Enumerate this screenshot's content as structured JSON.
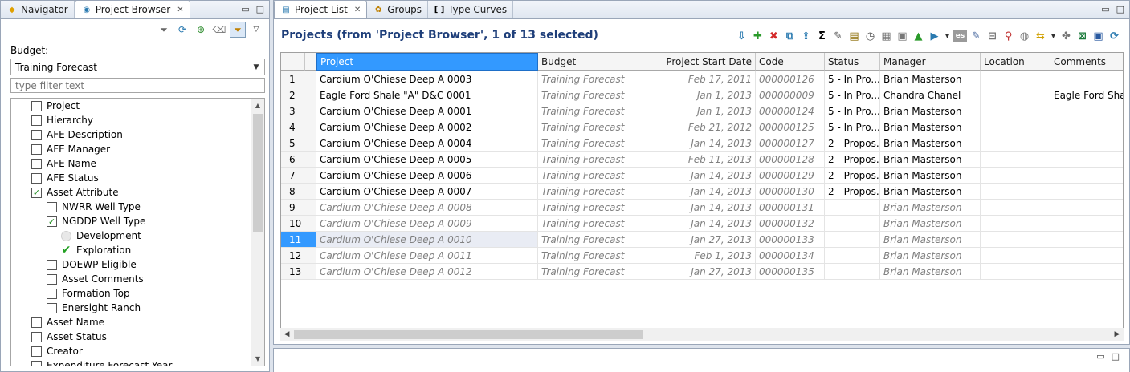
{
  "left_tabs": [
    {
      "label": "Navigator",
      "closable": false
    },
    {
      "label": "Project Browser",
      "closable": true
    }
  ],
  "budget": {
    "label": "Budget:",
    "selected": "Training Forecast",
    "filter_placeholder": "type filter text"
  },
  "tree_items": [
    {
      "label": "Project",
      "state": "unchecked"
    },
    {
      "label": "Hierarchy",
      "state": "unchecked"
    },
    {
      "label": "AFE Description",
      "state": "unchecked"
    },
    {
      "label": "AFE Manager",
      "state": "unchecked"
    },
    {
      "label": "AFE Name",
      "state": "unchecked"
    },
    {
      "label": "AFE Status",
      "state": "unchecked"
    },
    {
      "label": "Asset Attribute",
      "state": "checked"
    },
    {
      "label": "NWRR Well Type",
      "state": "unchecked"
    },
    {
      "label": "NGDDP Well Type",
      "state": "checked"
    },
    {
      "label": "Development",
      "state": "radio"
    },
    {
      "label": "Exploration",
      "state": "tick"
    },
    {
      "label": "DOEWP Eligible",
      "state": "unchecked"
    },
    {
      "label": "Asset Comments",
      "state": "unchecked"
    },
    {
      "label": "Formation Top",
      "state": "unchecked"
    },
    {
      "label": "Enersight Ranch",
      "state": "unchecked"
    },
    {
      "label": "Asset Name",
      "state": "unchecked"
    },
    {
      "label": "Asset Status",
      "state": "unchecked"
    },
    {
      "label": "Creator",
      "state": "unchecked"
    },
    {
      "label": "Expenditure Forecast Year",
      "state": "unchecked"
    }
  ],
  "right_tabs": [
    {
      "label": "Project List",
      "closable": true
    },
    {
      "label": "Groups",
      "closable": false
    },
    {
      "label": "Type Curves",
      "closable": false
    }
  ],
  "grid": {
    "title": "Projects (from 'Project Browser', 1 of 13 selected)",
    "columns": [
      "Project",
      "Budget",
      "Project Start Date",
      "Code",
      "Status",
      "Manager",
      "Location",
      "Comments"
    ],
    "rows": [
      {
        "num": "1",
        "project": "Cardium O'Chiese Deep A 0003",
        "budget": "Training Forecast",
        "start": "Feb 17, 2011",
        "code": "000000126",
        "status": "5 - In Pro...",
        "manager": "Brian Masterson",
        "location": "",
        "comments": "",
        "active": true
      },
      {
        "num": "2",
        "project": "Eagle Ford Shale \"A\" D&C 0001",
        "budget": "Training Forecast",
        "start": "Jan 1, 2013",
        "code": "000000009",
        "status": "5 - In Pro...",
        "manager": "Chandra Chanel",
        "location": "",
        "comments": "Eagle Ford Shale...",
        "active": true
      },
      {
        "num": "3",
        "project": "Cardium O'Chiese Deep A 0001",
        "budget": "Training Forecast",
        "start": "Jan 1, 2013",
        "code": "000000124",
        "status": "5 - In Pro...",
        "manager": "Brian Masterson",
        "location": "",
        "comments": "",
        "active": true
      },
      {
        "num": "4",
        "project": "Cardium O'Chiese Deep A 0002",
        "budget": "Training Forecast",
        "start": "Feb 21, 2012",
        "code": "000000125",
        "status": "5 - In Pro...",
        "manager": "Brian Masterson",
        "location": "",
        "comments": "",
        "active": true
      },
      {
        "num": "5",
        "project": "Cardium O'Chiese Deep A 0004",
        "budget": "Training Forecast",
        "start": "Jan 14, 2013",
        "code": "000000127",
        "status": "2 - Propos...",
        "manager": "Brian Masterson",
        "location": "",
        "comments": "",
        "active": true
      },
      {
        "num": "6",
        "project": "Cardium O'Chiese Deep A 0005",
        "budget": "Training Forecast",
        "start": "Feb 11, 2013",
        "code": "000000128",
        "status": "2 - Propos...",
        "manager": "Brian Masterson",
        "location": "",
        "comments": "",
        "active": true
      },
      {
        "num": "7",
        "project": "Cardium O'Chiese Deep A 0006",
        "budget": "Training Forecast",
        "start": "Jan 14, 2013",
        "code": "000000129",
        "status": "2 - Propos...",
        "manager": "Brian Masterson",
        "location": "",
        "comments": "",
        "active": true
      },
      {
        "num": "8",
        "project": "Cardium O'Chiese Deep A 0007",
        "budget": "Training Forecast",
        "start": "Jan 14, 2013",
        "code": "000000130",
        "status": "2 - Propos...",
        "manager": "Brian Masterson",
        "location": "",
        "comments": "",
        "active": true
      },
      {
        "num": "9",
        "project": "Cardium O'Chiese Deep A 0008",
        "budget": "Training Forecast",
        "start": "Jan 14, 2013",
        "code": "000000131",
        "status": "",
        "manager": "Brian Masterson",
        "location": "",
        "comments": "",
        "active": false
      },
      {
        "num": "10",
        "project": "Cardium O'Chiese Deep A 0009",
        "budget": "Training Forecast",
        "start": "Jan 14, 2013",
        "code": "000000132",
        "status": "",
        "manager": "Brian Masterson",
        "location": "",
        "comments": "",
        "active": false
      },
      {
        "num": "11",
        "project": "Cardium O'Chiese Deep A 0010",
        "budget": "Training Forecast",
        "start": "Jan 27, 2013",
        "code": "000000133",
        "status": "",
        "manager": "Brian Masterson",
        "location": "",
        "comments": "",
        "active": false,
        "selected": true
      },
      {
        "num": "12",
        "project": "Cardium O'Chiese Deep A 0011",
        "budget": "Training Forecast",
        "start": "Feb 1, 2013",
        "code": "000000134",
        "status": "",
        "manager": "Brian Masterson",
        "location": "",
        "comments": "",
        "active": false
      },
      {
        "num": "13",
        "project": "Cardium O'Chiese Deep A 0012",
        "budget": "Training Forecast",
        "start": "Jan 27, 2013",
        "code": "000000135",
        "status": "",
        "manager": "Brian Masterson",
        "location": "",
        "comments": "",
        "active": false
      }
    ]
  },
  "toolbar_icons": [
    "import-icon",
    "add-icon",
    "delete-icon",
    "copy-icon",
    "export-icon",
    "sum-icon",
    "edit-icon",
    "notes-icon",
    "clock-icon",
    "calendar-icon",
    "form-icon",
    "chart-icon",
    "play-icon",
    "dropdown-icon",
    "es-icon",
    "doc-icon",
    "lock-icon",
    "map-pin-icon",
    "globe-icon",
    "sync-icon",
    "dropdown-icon",
    "plant-icon",
    "excel-icon",
    "save-icon",
    "refresh-icon"
  ],
  "colors": {
    "accent": "#3399ff",
    "title": "#1f3f7a",
    "add": "#2a9a2a",
    "delete": "#d42a2a"
  }
}
